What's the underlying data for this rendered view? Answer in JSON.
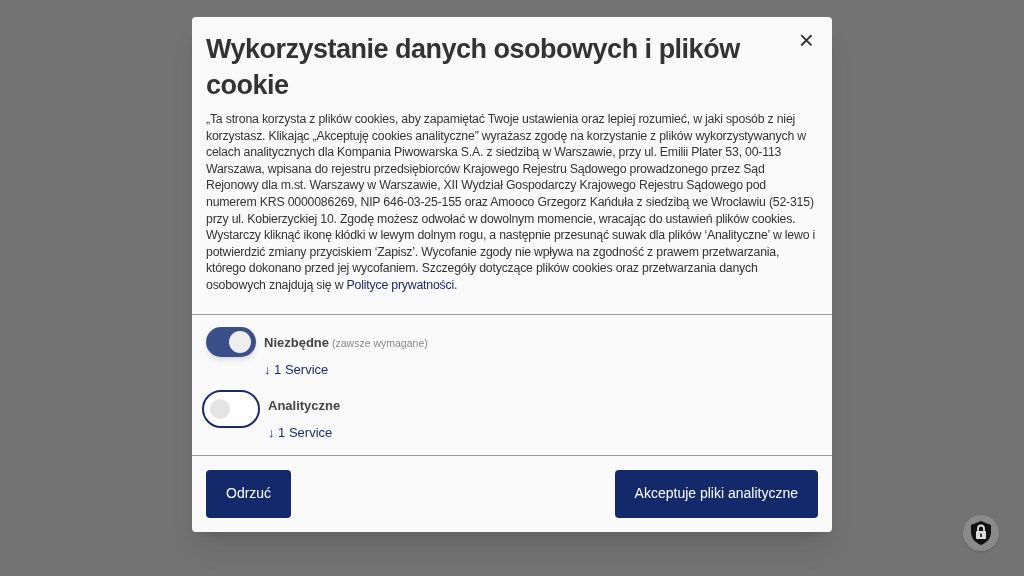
{
  "dialog": {
    "title": "Wykorzystanie danych osobowych i plików cookie",
    "close": "×",
    "text": "„Ta strona korzysta z plików cookies, aby zapamiętać Twoje ustawienia oraz lepiej rozumieć, w jaki sposób z niej korzystasz. Klikając „Akceptuję cookies analityczne” wyrażasz zgodę na korzystanie z plików wykorzystywanych w celach analitycznych dla Kompania Piwowarska S.A. z siedzibą w Warszawie, przy ul. Emilii Plater 53, 00-113 Warszawa, wpisana do rejestru przedsiębiorców Krajowego Rejestru Sądowego prowadzonego przez Sąd Rejonowy dla m.st. Warszawy w Warszawie, XII Wydział Gospodarczy Krajowego Rejestru Sądowego pod numerem KRS 0000086269, NIP 646-03-25-155 oraz Amooco Grzegorz Kańduła z siedzibą we Wrocławiu (52-315) przy ul. Kobierzyckiej 10. Zgodę możesz odwołać w dowolnym momencie, wracając do ustawień plików cookies. Wystarczy kliknąć ikonę kłódki w lewym dolnym rogu, a następnie przesunąć suwak dla plików ‘Analityczne’ w lewo i potwierdzić zmiany przyciskiem ‘Zapisz’. Wycofanie zgody nie wpływa na zgodność z prawem przetwarzania, którego dokonano przed jej wycofaniem. Szczegóły dotyczące plików cookies oraz przetwarzania danych osobowych znajdują się w",
    "link": "Polityce prywatności",
    "text_end": ".",
    "categories": [
      {
        "name": "Niezbędne",
        "note": "(zawsze wymagane)",
        "on": true,
        "services": "↓ 1 Service"
      },
      {
        "name": "Analityczne",
        "on": false,
        "services": "↓ 1 Service"
      }
    ],
    "buttons": [
      {
        "label": "Odrzuć"
      },
      {
        "label": "Akceptuje pliki analityczne"
      }
    ]
  }
}
